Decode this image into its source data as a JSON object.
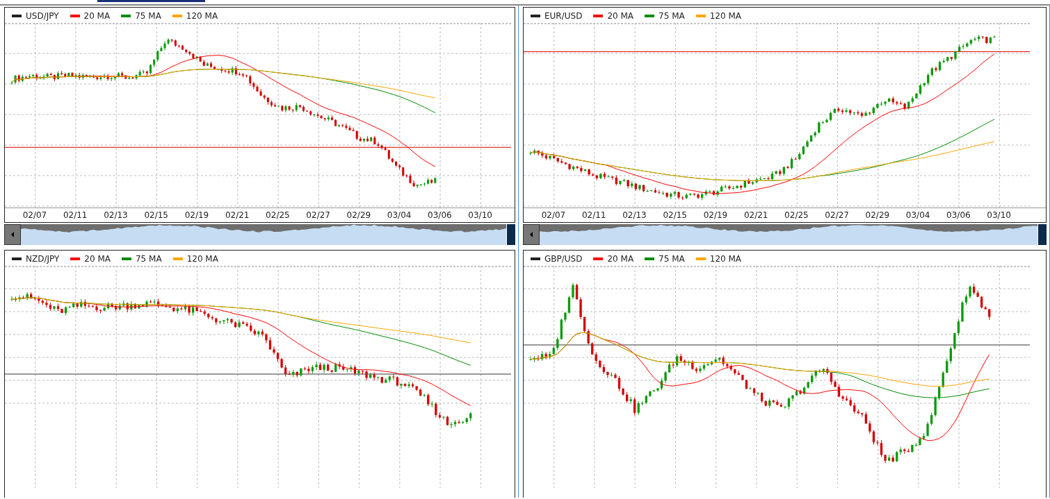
{
  "panels": [
    {
      "symbol": "USD/JPY",
      "legend": [
        {
          "label": "20 MA",
          "color": "#ff0000"
        },
        {
          "label": "75 MA",
          "color": "#008c00"
        },
        {
          "label": "120 MA",
          "color": "#ffa500"
        }
      ],
      "dates": [
        "02/07",
        "02/11",
        "02/13",
        "02/15",
        "02/19",
        "02/21",
        "02/25",
        "02/27",
        "02/29",
        "03/04",
        "03/06",
        "03/10"
      ]
    },
    {
      "symbol": "EUR/USD",
      "legend": [
        {
          "label": "20 MA",
          "color": "#ff0000"
        },
        {
          "label": "75 MA",
          "color": "#008c00"
        },
        {
          "label": "120 MA",
          "color": "#ffa500"
        }
      ],
      "dates": [
        "02/07",
        "02/11",
        "02/13",
        "02/15",
        "02/19",
        "02/21",
        "02/25",
        "02/27",
        "02/29",
        "03/04",
        "03/06",
        "03/10"
      ]
    },
    {
      "symbol": "NZD/JPY",
      "legend": [
        {
          "label": "20 MA",
          "color": "#ff0000"
        },
        {
          "label": "75 MA",
          "color": "#008c00"
        },
        {
          "label": "120 MA",
          "color": "#ffa500"
        }
      ]
    },
    {
      "symbol": "GBP/USD",
      "legend": [
        {
          "label": "20 MA",
          "color": "#ff0000"
        },
        {
          "label": "75 MA",
          "color": "#008c00"
        },
        {
          "label": "120 MA",
          "color": "#ffa500"
        }
      ]
    }
  ]
}
